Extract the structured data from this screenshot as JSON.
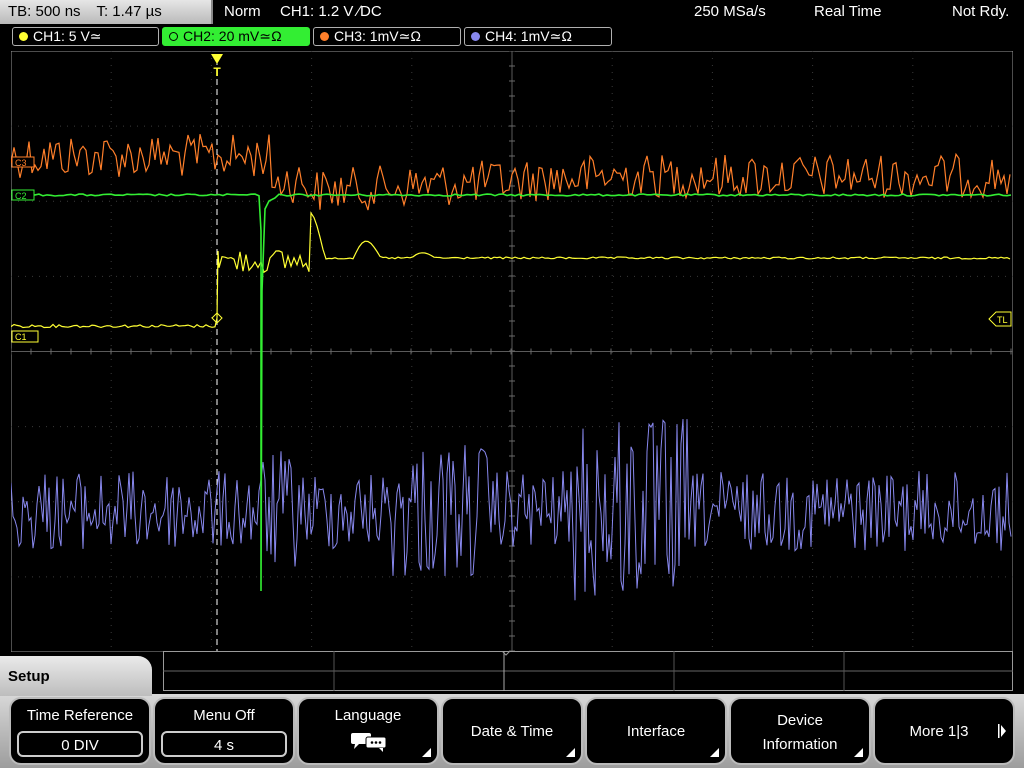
{
  "topbar": {
    "timebase": "TB: 500 ns",
    "trigger_time": "T: 1.47 µs",
    "mode": "Norm",
    "trigger": "CH1: 1.2 V ∕DC",
    "sample_rate": "250 MSa/s",
    "acquisition": "Real Time",
    "ready_state": "Not Rdy."
  },
  "channels": [
    {
      "label": "CH1: 5 V≃",
      "color": "#ffff33"
    },
    {
      "label": "CH2: 20 mV≃Ω",
      "color": "#33ee33"
    },
    {
      "label": "CH3: 1mV≃Ω",
      "color": "#ff7f2a"
    },
    {
      "label": "CH4: 1mV≃Ω",
      "color": "#8888ee"
    }
  ],
  "markers": {
    "trigger_pos": "T",
    "ch3": "C3",
    "ch2": "C2",
    "ch1": "C1",
    "trigger_level": "TL"
  },
  "menu": {
    "title": "Setup",
    "softkeys": [
      {
        "label": "Time Reference",
        "value": "0 DIV"
      },
      {
        "label": "Menu Off",
        "value": "4 s"
      },
      {
        "label": "Language",
        "icon": "speech-bubbles-icon"
      },
      {
        "label": "Date & Time"
      },
      {
        "label": "Interface"
      },
      {
        "label": "Device",
        "label2": "Information"
      },
      {
        "label": "More 1|3"
      }
    ]
  }
}
